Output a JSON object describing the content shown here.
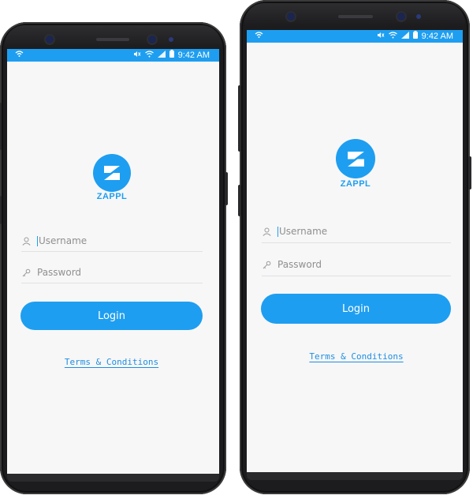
{
  "status_bar": {
    "time": "9:42 AM",
    "icons": [
      "wifi-call-icon",
      "mute-icon",
      "wifi-icon",
      "signal-icon",
      "battery-icon"
    ]
  },
  "app": {
    "brand_name": "ZAPPL",
    "logo_letter": "Z",
    "accent_color": "#1e9ef0"
  },
  "login_form": {
    "username_placeholder": "Username",
    "password_placeholder": "Password",
    "login_label": "Login",
    "terms_link": "Terms & Conditions"
  }
}
